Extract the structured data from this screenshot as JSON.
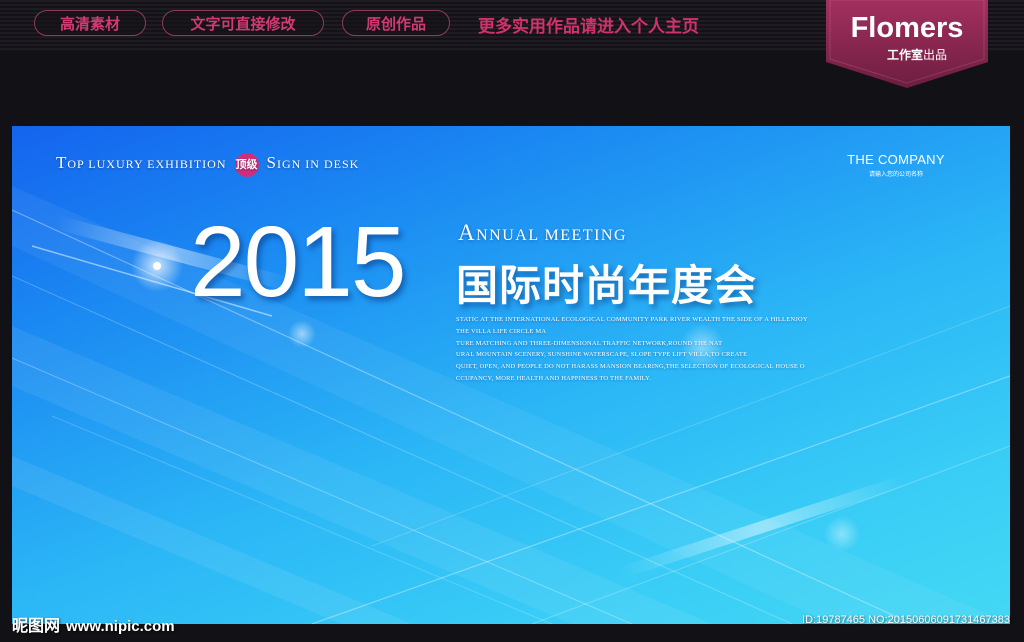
{
  "header": {
    "pills": [
      "高清素材",
      "文字可直接修改",
      "原创作品"
    ],
    "promo": "更多实用作品请进入个人主页",
    "brand_name": "Flomers",
    "brand_sub_bold": "工作室",
    "brand_sub_light": "出品"
  },
  "banner": {
    "tagline": {
      "t1": "T",
      "t2": "OP LUXURY EXHIBITION",
      "badge": "顶级",
      "s1": "S",
      "s2": "IGN IN DESK"
    },
    "company": {
      "name": "THE COMPANY",
      "sub": "请输入您的公司名称"
    },
    "year": "2015",
    "annual": {
      "a1": "A",
      "a2": "NNUAL MEETING"
    },
    "cn_title": "国际时尚年度会",
    "desc_lines": [
      "STATIC AT THE INTERNATIONAL ECOLOGICAL COMMUNITY PARK RIVER WEALTH THE SIDE OF A HILLENJOY",
      "THE VILLA LIFE CIRCLE MA",
      "TURE MATCHING AND THREE-DIMENSIONAL TRAFFIC NETWORK,ROUND THE NAT",
      "URAL MOUNTAIN SCENERY, SUNSHINE WATERSCAPE, SLOPE TYPE LIFT VILLA,TO CREATE",
      "QUIET, OPEN, AND PEOPLE DO NOT HARASS MANSION BEARING,THE SELECTION OF ECOLOGICAL HOUSE O",
      "CCUPANCY, MORE HEALTH AND HAPPINESS TO THE FAMILY."
    ]
  },
  "watermark": {
    "left_cn": "昵图网",
    "left_url": "www.nipic.com",
    "right": "ID:19787465 NO:20150606091731467383"
  },
  "colors": {
    "accent": "#d0336c",
    "ribbon": "#8e2855",
    "banner_start": "#1464ee",
    "banner_end": "#43d8f4"
  }
}
